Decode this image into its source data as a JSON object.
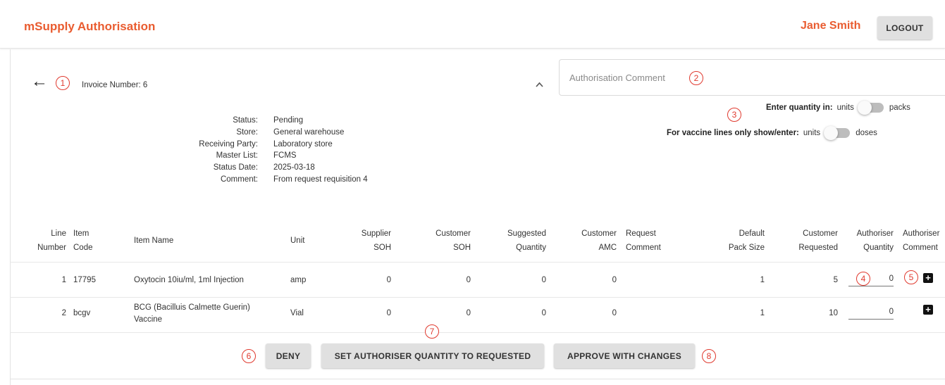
{
  "header": {
    "app_title": "mSupply Authorisation",
    "user_name": "Jane Smith",
    "logout_label": "LOGOUT"
  },
  "invoice": {
    "back_icon": "arrow-left-icon",
    "number_label": "Invoice Number:  6",
    "collapse_icon": "chevron-up-icon"
  },
  "authorisation_comment": {
    "placeholder": "Authorisation Comment"
  },
  "quantity_toggle": {
    "label": "Enter quantity in:",
    "left": "units",
    "right": "packs"
  },
  "vaccine_toggle": {
    "label": "For vaccine lines only show/enter:",
    "left": "units",
    "right": "doses"
  },
  "details": [
    {
      "key": "Status:",
      "value": "Pending"
    },
    {
      "key": "Store:",
      "value": "General warehouse"
    },
    {
      "key": "Receiving Party:",
      "value": "Laboratory store"
    },
    {
      "key": "Master List:",
      "value": "FCMS"
    },
    {
      "key": "Status Date:",
      "value": "2025-03-18"
    },
    {
      "key": "Comment:",
      "value": "From request requisition 4"
    }
  ],
  "table": {
    "columns": {
      "line_number": [
        "Line",
        "Number"
      ],
      "item_code": [
        "Item",
        "Code"
      ],
      "item_name": "Item Name",
      "unit": "Unit",
      "supplier_soh": [
        "Supplier",
        "SOH"
      ],
      "customer_soh": [
        "Customer",
        "SOH"
      ],
      "suggested_quantity": [
        "Suggested",
        "Quantity"
      ],
      "customer_amc": [
        "Customer",
        "AMC"
      ],
      "request_comment": [
        "Request",
        "Comment"
      ],
      "default_pack_size": [
        "Default",
        "Pack Size"
      ],
      "customer_requested": [
        "Customer",
        "Requested"
      ],
      "authoriser_quantity": [
        "Authoriser",
        "Quantity"
      ],
      "authoriser_comment": [
        "Authoriser",
        "Comment"
      ]
    },
    "rows": [
      {
        "line": "1",
        "code": "17795",
        "name_line1": "Oxytocin 10iu/ml, 1ml Injection",
        "name_line2": "",
        "unit": "amp",
        "supplier_soh": "0",
        "customer_soh": "0",
        "suggested": "0",
        "amc": "0",
        "request_comment": "",
        "pack_size": "1",
        "requested": "5",
        "authoriser_qty": "0",
        "comment_icon": "add-comment-icon"
      },
      {
        "line": "2",
        "code": "bcgv",
        "name_line1": "BCG (Bacilluis Calmette Guerin)",
        "name_line2": "Vaccine",
        "unit": "Vial",
        "supplier_soh": "0",
        "customer_soh": "0",
        "suggested": "0",
        "amc": "0",
        "request_comment": "",
        "pack_size": "1",
        "requested": "10",
        "authoriser_qty": "0",
        "comment_icon": "add-comment-icon"
      }
    ]
  },
  "actions": {
    "deny": "DENY",
    "set_to_requested": "SET AUTHORISER QUANTITY TO REQUESTED",
    "approve": "APPROVE WITH CHANGES"
  },
  "annotations": [
    "1",
    "2",
    "3",
    "4",
    "5",
    "6",
    "7",
    "8"
  ],
  "colors": {
    "brand": "#e95c30",
    "annotation": "#e03a2f",
    "button": "#e0e0e0"
  }
}
